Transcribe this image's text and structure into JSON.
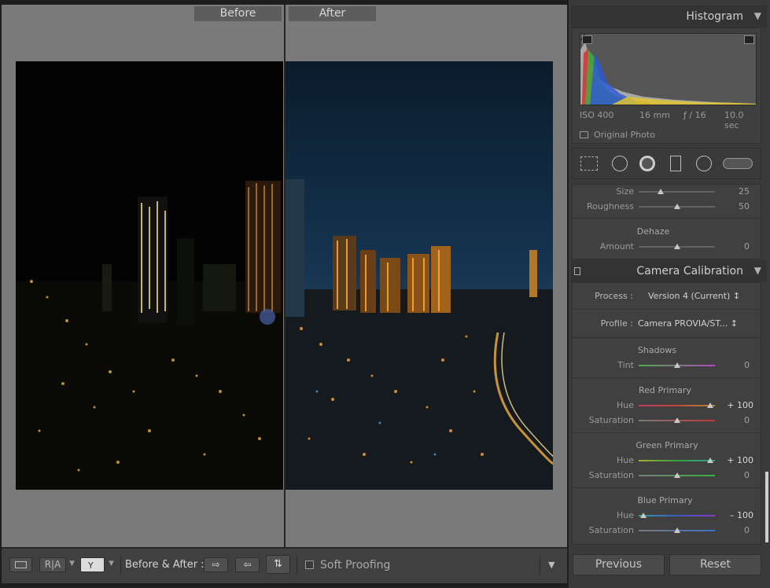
{
  "view": {
    "before_label": "Before",
    "after_label": "After"
  },
  "toolbar": {
    "before_after_label": "Before & After :",
    "soft_proofing_label": "Soft Proofing",
    "ra_label": "R|A"
  },
  "histogram": {
    "title": "Histogram",
    "iso": "ISO 400",
    "focal": "16 mm",
    "aperture": "ƒ / 16",
    "shutter": "10.0 sec",
    "original_photo_label": "Original Photo"
  },
  "brush": {
    "size_label": "Size",
    "size_value": "25",
    "roughness_label": "Roughness",
    "roughness_value": "50",
    "dehaze_title": "Dehaze",
    "amount_label": "Amount",
    "amount_value": "0"
  },
  "calibration": {
    "title": "Camera Calibration",
    "process_label": "Process :",
    "process_value": "Version 4 (Current) ↕",
    "profile_label": "Profile :",
    "profile_value": "Camera PROVIA/ST... ↕",
    "shadows_title": "Shadows",
    "tint_label": "Tint",
    "tint_value": "0",
    "red_title": "Red Primary",
    "red_hue_label": "Hue",
    "red_hue_value": "+ 100",
    "red_sat_label": "Saturation",
    "red_sat_value": "0",
    "green_title": "Green Primary",
    "green_hue_label": "Hue",
    "green_hue_value": "+ 100",
    "green_sat_label": "Saturation",
    "green_sat_value": "0",
    "blue_title": "Blue Primary",
    "blue_hue_label": "Hue",
    "blue_hue_value": "– 100",
    "blue_sat_label": "Saturation",
    "blue_sat_value": "0"
  },
  "buttons": {
    "previous": "Previous",
    "reset": "Reset"
  },
  "colors": {
    "panel_bg": "#3a3a3a",
    "view_bg": "#7a7a7a",
    "accent_orange": "#f0a030",
    "night_sky_after": "#0c2236"
  },
  "icons": [
    "crop-overlay-icon",
    "spot-removal-icon",
    "red-eye-icon",
    "graduated-filter-icon",
    "radial-filter-icon",
    "adjustment-brush-icon",
    "loupe-view-icon",
    "flag-icon",
    "swap-icon"
  ]
}
